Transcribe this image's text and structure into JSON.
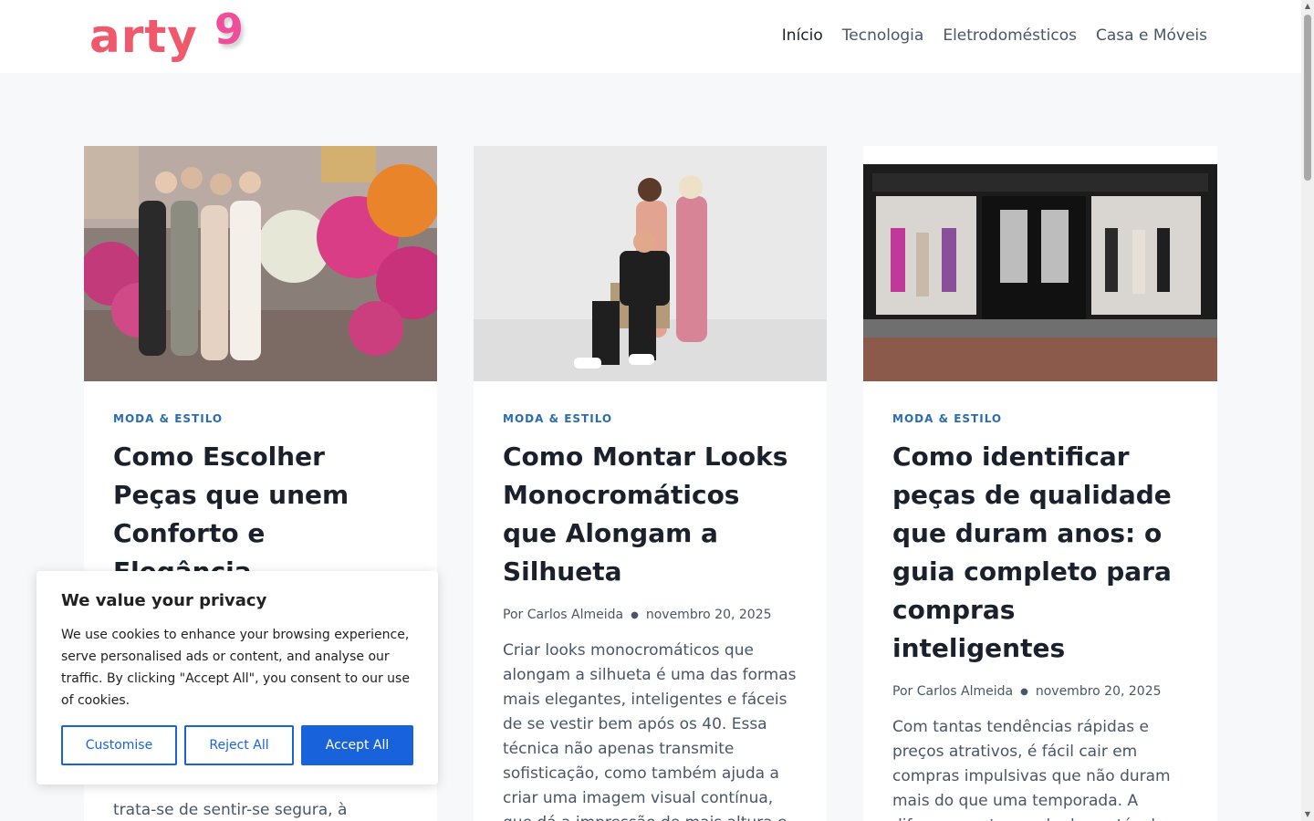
{
  "header": {
    "logo_text": "arty",
    "logo_digit": "9",
    "nav": [
      {
        "label": "Início"
      },
      {
        "label": "Tecnologia"
      },
      {
        "label": "Eletrodomésticos"
      },
      {
        "label": "Casa e Móveis"
      }
    ]
  },
  "posts": [
    {
      "category": "MODA & ESTILO",
      "title": "Como Escolher Peças que unem Conforto e Elegância",
      "author_prefix": "",
      "author": "",
      "date": "",
      "excerpt": "trata-se de sentir-se segura, à vontade e fiel à própria essência. A"
    },
    {
      "category": "MODA & ESTILO",
      "title": "Como Montar Looks Monocromáticos que Alongam a Silhueta",
      "author_prefix": "Por",
      "author": "Carlos Almeida",
      "date": "novembro 20, 2025",
      "excerpt": "Criar looks monocromáticos que alongam a silhueta é uma das formas mais elegantes, inteligentes e fáceis de se vestir bem após os 40. Essa técnica não apenas transmite sofisticação, como também ajuda a criar uma imagem visual contínua, que dá a impressão de mais altura e"
    },
    {
      "category": "MODA & ESTILO",
      "title": "Como identificar peças de qualidade que duram anos: o guia completo para compras inteligentes",
      "author_prefix": "Por",
      "author": "Carlos Almeida",
      "date": "novembro 20, 2025",
      "excerpt": "Com tantas tendências rápidas e preços atrativos, é fácil cair em compras impulsivas que não duram mais do que uma temporada. A diferença entre moda descartável e"
    }
  ],
  "cookie": {
    "title": "We value your privacy",
    "text": "We use cookies to enhance your browsing experience, serve personalised ads or content, and analyse our traffic. By clicking \"Accept All\", you consent to our use of cookies.",
    "customise": "Customise",
    "reject": "Reject All",
    "accept": "Accept All"
  },
  "colors": {
    "logo": "#f0596b",
    "category": "#2b6cb0",
    "cookie_accent": "#1863dc"
  }
}
